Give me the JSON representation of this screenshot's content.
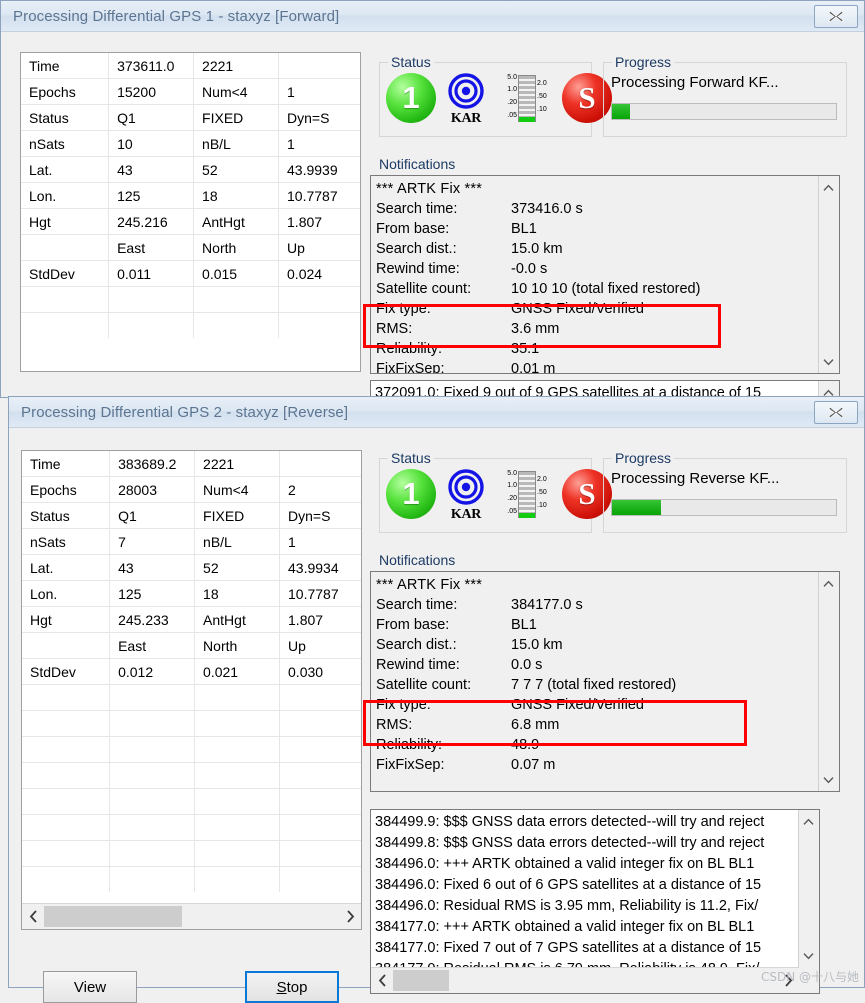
{
  "windows": [
    {
      "title": "Processing Differential GPS 1 - staxyz [Forward]",
      "close_icon": "close-icon",
      "grid": [
        [
          "Time",
          "373611.0",
          "2221",
          ""
        ],
        [
          "Epochs",
          "15200",
          "Num<4",
          "1"
        ],
        [
          "Status",
          "Q1",
          "FIXED",
          "Dyn=S"
        ],
        [
          "nSats",
          "10",
          "nB/L",
          "1"
        ],
        [
          "Lat.",
          "43",
          "52",
          "43.9939"
        ],
        [
          "Lon.",
          "125",
          "18",
          "10.7787"
        ],
        [
          "Hgt",
          "245.216",
          "AntHgt",
          "1.807"
        ],
        [
          "",
          "East",
          "North",
          "Up"
        ],
        [
          "StdDev",
          "0.011",
          "0.015",
          "0.024"
        ],
        [
          "",
          "",
          "",
          ""
        ],
        [
          "",
          "",
          "",
          ""
        ]
      ],
      "status": {
        "label": "Status",
        "quality_ball": "1",
        "kar_label": "KAR",
        "gauge_ticks_left": [
          "5.0",
          "1.0",
          ".20",
          ".05"
        ],
        "gauge_ticks_right": [
          "2.0",
          ".50",
          ".10"
        ],
        "solution_ball": "S"
      },
      "progress": {
        "label": "Progress",
        "text": "Processing Forward KF...",
        "percent": 8
      },
      "notifications": {
        "label": "Notifications",
        "header": "*** ARTK Fix ***",
        "rows": [
          {
            "key": "Search time:",
            "value": "373416.0 s"
          },
          {
            "key": "From base:",
            "value": "BL1"
          },
          {
            "key": "Search dist.:",
            "value": "15.0 km"
          },
          {
            "key": "Rewind time:",
            "value": "-0.0 s"
          },
          {
            "key": "Satellite count:",
            "value": "10  10  10  (total  fixed  restored)"
          },
          {
            "key": "Fix type:",
            "value": "GNSS Fixed/Verified"
          },
          {
            "key": "RMS:",
            "value": "3.6 mm"
          },
          {
            "key": "Reliability:",
            "value": "35.1"
          },
          {
            "key": "FixFixSep:",
            "value": "0.01 m"
          }
        ]
      },
      "log": [
        "372091.0:   Fixed 9 out of 9 GPS satellites at a distance of 15"
      ]
    },
    {
      "title": "Processing Differential GPS 2 - staxyz [Reverse]",
      "close_icon": "close-icon",
      "grid": [
        [
          "Time",
          "383689.2",
          "2221",
          ""
        ],
        [
          "Epochs",
          "28003",
          "Num<4",
          "2"
        ],
        [
          "Status",
          "Q1",
          "FIXED",
          "Dyn=S"
        ],
        [
          "nSats",
          "7",
          "nB/L",
          "1"
        ],
        [
          "Lat.",
          "43",
          "52",
          "43.9934"
        ],
        [
          "Lon.",
          "125",
          "18",
          "10.7787"
        ],
        [
          "Hgt",
          "245.233",
          "AntHgt",
          "1.807"
        ],
        [
          "",
          "East",
          "North",
          "Up"
        ],
        [
          "StdDev",
          "0.012",
          "0.021",
          "0.030"
        ],
        [
          "",
          "",
          "",
          ""
        ],
        [
          "",
          "",
          "",
          ""
        ],
        [
          "",
          "",
          "",
          ""
        ],
        [
          "",
          "",
          "",
          ""
        ],
        [
          "",
          "",
          "",
          ""
        ],
        [
          "",
          "",
          "",
          ""
        ],
        [
          "",
          "",
          "",
          ""
        ],
        [
          "",
          "",
          "",
          ""
        ]
      ],
      "status": {
        "label": "Status",
        "quality_ball": "1",
        "kar_label": "KAR",
        "gauge_ticks_left": [
          "5.0",
          "1.0",
          ".20",
          ".05"
        ],
        "gauge_ticks_right": [
          "2.0",
          ".50",
          ".10"
        ],
        "solution_ball": "S"
      },
      "progress": {
        "label": "Progress",
        "text": "Processing Reverse KF...",
        "percent": 22
      },
      "notifications": {
        "label": "Notifications",
        "header": "*** ARTK Fix ***",
        "rows": [
          {
            "key": "Search time:",
            "value": "384177.0 s"
          },
          {
            "key": "From base:",
            "value": "BL1"
          },
          {
            "key": "Search dist.:",
            "value": "15.0 km"
          },
          {
            "key": "Rewind time:",
            "value": "0.0 s"
          },
          {
            "key": "Satellite count:",
            "value": "7  7  7  (total  fixed  restored)"
          },
          {
            "key": "Fix type:",
            "value": "GNSS Fixed/Verified"
          },
          {
            "key": "RMS:",
            "value": "6.8 mm"
          },
          {
            "key": "Reliability:",
            "value": "48.9"
          },
          {
            "key": "FixFixSep:",
            "value": "0.07 m"
          }
        ]
      },
      "log": [
        "384499.9: $$$ GNSS data errors detected--will try and reject",
        "384499.8: $$$ GNSS data errors detected--will try and reject",
        "384496.0: +++ ARTK obtained a valid integer fix on BL BL1",
        "384496.0:   Fixed 6 out of 6 GPS satellites at a distance of 15",
        "384496.0:   Residual RMS is 3.95 mm, Reliability is 11.2, Fix/",
        "384177.0: +++ ARTK obtained a valid integer fix on BL BL1",
        "384177.0:   Fixed 7 out of 7 GPS satellites at a distance of 15",
        "384177.0:   Residual RMS is 6.79 mm, Reliability is 48.9, Fix/"
      ],
      "buttons": {
        "view": "View",
        "stop_prefix": "S",
        "stop_rest": "top"
      }
    }
  ],
  "watermark": "CSDN @十八与她",
  "colors": {
    "accent": "#ff0000",
    "progress_green": "#06a406",
    "focus_blue": "#0a78d7",
    "title_text": "#5c7591"
  }
}
